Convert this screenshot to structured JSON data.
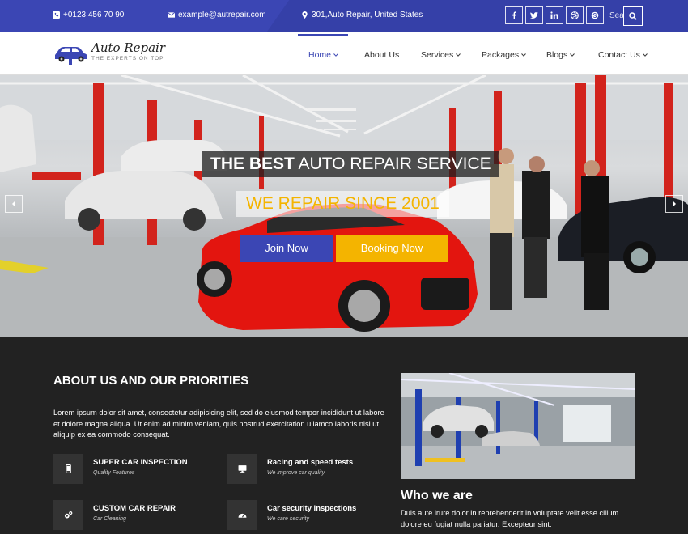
{
  "topbar": {
    "phone": "+0123 456 70 90",
    "email": "example@autrepair.com",
    "address": "301,Auto Repair, United States",
    "social": [
      "f",
      "t",
      "in",
      "dribbble",
      "skype"
    ],
    "search_placeholder": "Search"
  },
  "header": {
    "logo_title": "Auto Repair",
    "logo_tagline": "THE EXPERTS ON TOP",
    "nav": [
      {
        "label": "Home",
        "dropdown": true,
        "active": true
      },
      {
        "label": "About Us",
        "dropdown": false
      },
      {
        "label": "Services",
        "dropdown": true
      },
      {
        "label": "Packages",
        "dropdown": true
      },
      {
        "label": "Blogs",
        "dropdown": true
      },
      {
        "label": "Contact Us",
        "dropdown": true
      }
    ]
  },
  "hero": {
    "title_bold": "THE BEST",
    "title_rest": " AUTO REPAIR SERVICE",
    "subtitle": "WE REPAIR SINCE 2001",
    "join_label": "Join Now",
    "booking_label": "Booking Now"
  },
  "about": {
    "title": "ABOUT US AND OUR PRIORITIES",
    "body": "Lorem ipsum dolor sit amet, consectetur adipisicing elit, sed do eiusmod tempor incididunt ut labore et dolore magna aliqua. Ut enim ad minim veniam, quis nostrud exercitation ullamco laboris nisi ut aliquip ex ea commodo consequat.",
    "features": [
      {
        "title": "SUPER CAR INSPECTION",
        "subtitle": "Quality Features",
        "icon": "mobile-icon"
      },
      {
        "title": "Racing and speed tests",
        "subtitle": "We improve car quality",
        "icon": "desktop-icon"
      },
      {
        "title": "CUSTOM CAR REPAIR",
        "subtitle": "Car Cleaning",
        "icon": "gears-icon"
      },
      {
        "title": "Car security inspections",
        "subtitle": "We care security",
        "icon": "dashboard-icon"
      }
    ],
    "who_title": "Who we are",
    "who_body": "Duis aute irure dolor in reprehenderit in voluptate velit esse cillum dolore eu fugiat nulla pariatur. Excepteur sint."
  },
  "colors": {
    "primary": "#3b46b4",
    "accent": "#f4b400",
    "dark": "#222222"
  }
}
